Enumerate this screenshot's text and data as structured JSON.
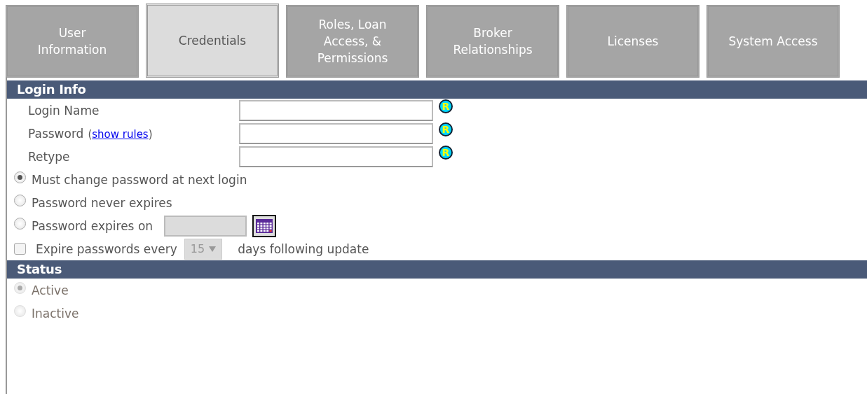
{
  "tabs": [
    {
      "label": "User Information",
      "selected": false
    },
    {
      "label": "Credentials",
      "selected": true
    },
    {
      "label": "Roles, Loan Access, & Permissions",
      "selected": false
    },
    {
      "label": "Broker Relationships",
      "selected": false
    },
    {
      "label": "Licenses",
      "selected": false
    },
    {
      "label": "System Access",
      "selected": false
    }
  ],
  "login_info": {
    "title": "Login Info",
    "fields": [
      {
        "label": "Login Name",
        "required_mark": "R"
      },
      {
        "label": "Password",
        "link_open": "(",
        "link": "show rules",
        "link_close": ")",
        "required_mark": "R"
      },
      {
        "label": "Retype",
        "required_mark": "R"
      }
    ],
    "expiry_options": [
      {
        "label": "Must change password at next login",
        "selected": true
      },
      {
        "label": "Password never expires",
        "selected": false
      },
      {
        "label": "Password expires on",
        "selected": false,
        "kind": "date"
      }
    ],
    "expire_every": {
      "label": "Expire passwords every",
      "checked": false,
      "value": "15",
      "suffix": "days following update",
      "disabled": true
    }
  },
  "status": {
    "title": "Status",
    "disabled": true,
    "options": [
      {
        "label": "Active",
        "selected": true
      },
      {
        "label": "Inactive",
        "selected": false
      }
    ]
  }
}
